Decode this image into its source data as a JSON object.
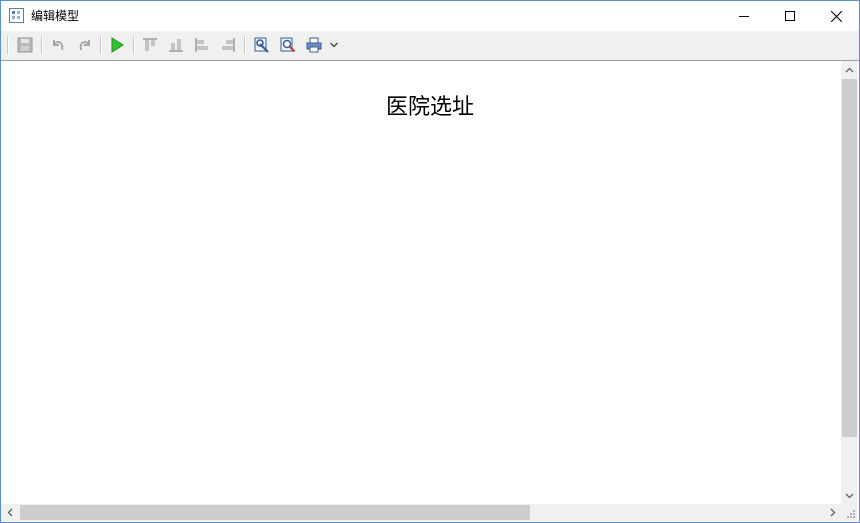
{
  "window": {
    "title": "编辑模型",
    "accent_color": "#5b8bd0",
    "icons": {
      "app": "grid-icon",
      "minimize": "minimize-icon",
      "maximize": "maximize-icon",
      "close": "close-icon"
    }
  },
  "toolbar": {
    "items": [
      {
        "name": "save-button",
        "icon": "floppy-disk-icon",
        "enabled": false
      },
      {
        "name": "undo-button",
        "icon": "undo-icon",
        "enabled": false
      },
      {
        "name": "redo-button",
        "icon": "redo-icon",
        "enabled": false
      },
      {
        "name": "run-button",
        "icon": "play-icon",
        "enabled": true,
        "color": "#22a722"
      },
      {
        "name": "align-top-button",
        "icon": "align-top-icon",
        "enabled": false
      },
      {
        "name": "align-bottom-button",
        "icon": "align-bottom-icon",
        "enabled": false
      },
      {
        "name": "align-left-button",
        "icon": "align-left-icon",
        "enabled": false
      },
      {
        "name": "align-right-button",
        "icon": "align-right-icon",
        "enabled": false
      },
      {
        "name": "settings-button",
        "icon": "wrench-icon",
        "enabled": true
      },
      {
        "name": "preview-button",
        "icon": "magnifier-icon",
        "enabled": true
      },
      {
        "name": "print-button",
        "icon": "printer-icon",
        "enabled": true
      },
      {
        "name": "more-button",
        "icon": "chevron-down-icon",
        "enabled": true
      }
    ]
  },
  "document": {
    "title": "医院选址"
  },
  "scrollbars": {
    "vertical_thumb_fraction": 0.88,
    "horizontal_thumb_fraction": 0.62
  }
}
